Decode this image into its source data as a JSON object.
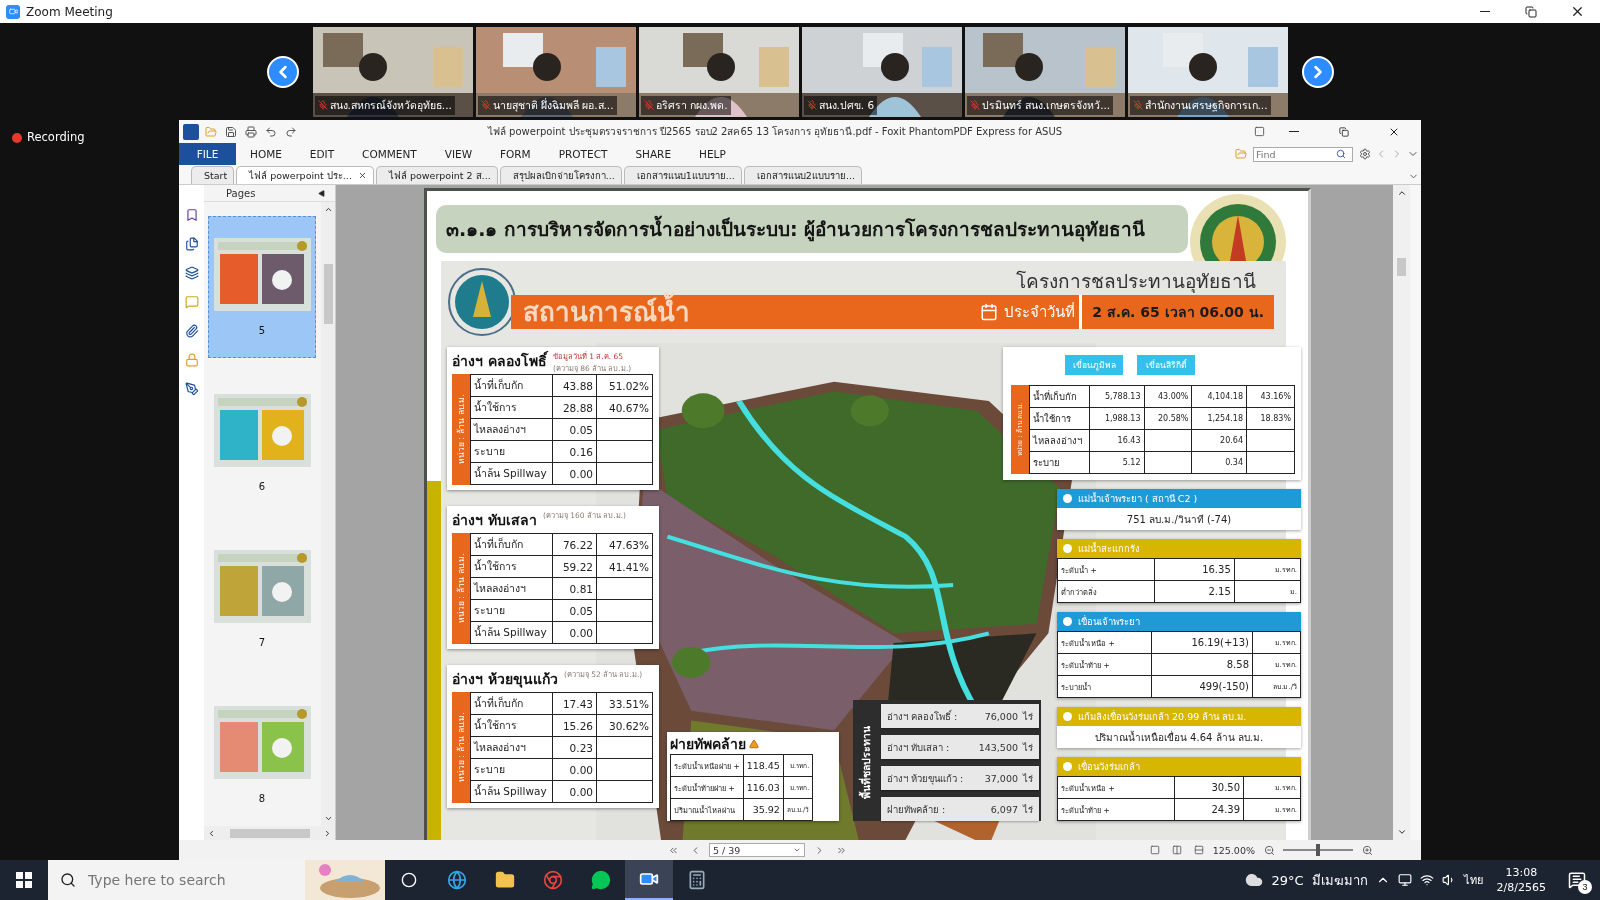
{
  "window": {
    "title": "Zoom Meeting"
  },
  "participants": [
    {
      "name": "สนง.สหกรณ์จังหวัดอุทัยธ..."
    },
    {
      "name": "นายสุชาติ ผึ่งฉิมพลี ผอ.ส..."
    },
    {
      "name": "อริศรา กผง.พด."
    },
    {
      "name": "สนง.ปศข. 6"
    },
    {
      "name": "ปรมินทร์ สนง.เกษตรจังหวั..."
    },
    {
      "name": "สำนักงานเศรษฐกิจการเก..."
    }
  ],
  "recording": "Recording",
  "viewer": {
    "title": "ไฟล์ powerpoint ประชุมตรวจราชการ ปี2565 รอบ2 2สค65 13 โครงการ อุทัยธานี.pdf - Foxit PhantomPDF Express for ASUS",
    "menu": [
      {
        "label": "FILE",
        "selected": true
      },
      {
        "label": "HOME",
        "selected": false
      },
      {
        "label": "EDIT",
        "selected": false
      },
      {
        "label": "COMMENT",
        "selected": false
      },
      {
        "label": "VIEW",
        "selected": false
      },
      {
        "label": "FORM",
        "selected": false
      },
      {
        "label": "PROTECT",
        "selected": false
      },
      {
        "label": "SHARE",
        "selected": false
      },
      {
        "label": "HELP",
        "selected": false
      }
    ],
    "search": {
      "placeholder": "Find"
    },
    "tabs": [
      {
        "label": "Start",
        "selected": false
      },
      {
        "label": "ไฟล์ powerpoint ประ...",
        "selected": true
      },
      {
        "label": "ไฟล์ powerpoint 2 ส...",
        "selected": false
      },
      {
        "label": "สรุปผลเบิกจ่ายโครงกา...",
        "selected": false
      },
      {
        "label": "เอกสารแนบ1แบบราย...",
        "selected": false
      },
      {
        "label": "เอกสารแนบ2แบบราย...",
        "selected": false
      }
    ],
    "pages_panel": {
      "title": "Pages",
      "pages": [
        {
          "number": "5",
          "selected": true
        },
        {
          "number": "6",
          "selected": false
        },
        {
          "number": "7",
          "selected": false
        },
        {
          "number": "8",
          "selected": false
        }
      ]
    },
    "status": {
      "page": "5 / 39",
      "zoom": "125.00%",
      "zoom_slider": {
        "level": 0.5
      }
    }
  },
  "slide": {
    "heading": "๓.๑.๑ การบริหารจัดการน้ำอย่างเป็นระบบ: ผู้อำนวยการโครงการชลประทานอุทัยธานี",
    "banner": "สถานการณ์น้ำ",
    "project": "โครงการชลประทานอุทัยธานี",
    "date_label": "ประจำวันที่",
    "date": "2 ส.ค. 65  เวลา 06.00 น.",
    "reservoirs": [
      {
        "name": "อ่างฯ คลองโพธิ์",
        "note": "ข้อมูลวันที่ 1 ส.ค. 65",
        "capacity": "(ความจุ 86 ล้าน ลบ.ม.)",
        "unit": "หน่วย : ล้าน ลบ.ม.",
        "rows": [
          {
            "label": "น้ำที่เก็บกัก",
            "value": "43.88",
            "percent": "51.02%"
          },
          {
            "label": "น้ำใช้การ",
            "value": "28.88",
            "percent": "40.67%"
          },
          {
            "label": "ไหลลงอ่างฯ",
            "value": "0.05"
          },
          {
            "label": "ระบาย",
            "value": "0.16"
          },
          {
            "label": "น้ำล้น Spillway",
            "value": "0.00"
          }
        ]
      },
      {
        "name": "อ่างฯ ทับเสลา",
        "capacity": "(ความจุ 160 ล้าน ลบ.ม.)",
        "unit": "หน่วย : ล้าน ลบ.ม.",
        "rows": [
          {
            "label": "น้ำที่เก็บกัก",
            "value": "76.22",
            "percent": "47.63%"
          },
          {
            "label": "น้ำใช้การ",
            "value": "59.22",
            "percent": "41.41%"
          },
          {
            "label": "ไหลลงอ่างฯ",
            "value": "0.81"
          },
          {
            "label": "ระบาย",
            "value": "0.05"
          },
          {
            "label": "น้ำล้น Spillway",
            "value": "0.00"
          }
        ]
      },
      {
        "name": "อ่างฯ ห้วยขุนแก้ว",
        "capacity": "(ความจุ 52 ล้าน ลบ.ม.)",
        "unit": "หน่วย : ล้าน ลบ.ม.",
        "rows": [
          {
            "label": "น้ำที่เก็บกัก",
            "value": "17.43",
            "percent": "33.51%"
          },
          {
            "label": "น้ำใช้การ",
            "value": "15.26",
            "percent": "30.62%"
          },
          {
            "label": "ไหลลงอ่างฯ",
            "value": "0.23"
          },
          {
            "label": "ระบาย",
            "value": "0.00"
          },
          {
            "label": "น้ำล้น Spillway",
            "value": "0.00"
          }
        ]
      }
    ],
    "weir": {
      "name": "ฝายทัพคล้าย",
      "rows": [
        {
          "label": "ระดับน้ำเหนือฝาย +",
          "value": "118.45",
          "unit": "ม.รทก."
        },
        {
          "label": "ระดับน้ำท้ายฝาย +",
          "value": "116.03",
          "unit": "ม.รทก."
        },
        {
          "label": "ปริมาณน้ำไหลผ่าน",
          "value": "35.92",
          "unit": "ลบ.ม./วิ"
        }
      ]
    },
    "irrigated": {
      "title": "พื้นที่ชลประทาน",
      "items": [
        {
          "label": "อ่างฯ คลองโพธิ์ :",
          "value": "76,000",
          "unit": "ไร่"
        },
        {
          "label": "อ่างฯ ทับเสลา :",
          "value": "143,500",
          "unit": "ไร่"
        },
        {
          "label": "อ่างฯ ห้วยขุนแก้ว :",
          "value": "37,000",
          "unit": "ไร่"
        },
        {
          "label": "ฝายทัพคล้าย :",
          "value": "6,097",
          "unit": "ไร่"
        }
      ]
    },
    "dams": {
      "columns": [
        "เขื่อนภูมิพล",
        "เขื่อนสิริกิติ์"
      ],
      "unit": "หน่วย : ล้าน ลบ.ม.",
      "rows": [
        {
          "label": "น้ำที่เก็บกัก",
          "values": [
            {
              "amount": "5,788.13",
              "percent": "43.00%"
            },
            {
              "amount": "4,104.18",
              "percent": "43.16%"
            }
          ]
        },
        {
          "label": "น้ำใช้การ",
          "values": [
            {
              "amount": "1,988.13",
              "percent": "20.58%"
            },
            {
              "amount": "1,254.18",
              "percent": "18.83%"
            }
          ]
        },
        {
          "label": "ไหลลงอ่างฯ",
          "values": [
            {
              "amount": "16.43"
            },
            {
              "amount": "20.64"
            }
          ]
        },
        {
          "label": "ระบาย",
          "values": [
            {
              "amount": "5.12"
            },
            {
              "amount": "0.34"
            }
          ]
        }
      ]
    },
    "panels": [
      {
        "kind": "reading",
        "title": "แม่น้ำเจ้าพระยา ( สถานี C2 )",
        "color": "#1e9bd7",
        "text": "751  ลบ.ม./วินาที (-74)"
      },
      {
        "kind": "rows",
        "title": "แม่น้ำสะแกกรัง",
        "color": "#d6b600",
        "rows": [
          {
            "label": "ระดับน้ำ +",
            "value": "16.35",
            "unit": "ม.รทก."
          },
          {
            "label": "ต่ำกว่าตลิ่ง",
            "value": "2.15",
            "unit": "ม."
          }
        ]
      },
      {
        "kind": "rows",
        "title": "เขื่อนเจ้าพระยา",
        "color": "#1e9bd7",
        "rows": [
          {
            "label": "ระดับน้ำเหนือ +",
            "value": "16.19(+13)",
            "unit": "ม.รทก."
          },
          {
            "label": "ระดับน้ำท้าย +",
            "value": "8.58",
            "unit": "ม.รทก."
          },
          {
            "label": "ระบายน้ำ",
            "value": "499(-150)",
            "unit": "ลบ.ม./วิ"
          }
        ]
      },
      {
        "kind": "reading",
        "title": "แก้มลิงเขื่อนวังร่มเกล้า 20.99 ล้าน ลบ.ม.",
        "color": "#d6b600",
        "text": "ปริมาณน้ำเหนือเขื่อน 4.64 ล้าน ลบ.ม."
      },
      {
        "kind": "rows",
        "title": "เขื่อนวังร่มเกล้า",
        "color": "#d6b600",
        "rows": [
          {
            "label": "ระดับน้ำเหนือ +",
            "value": "30.50",
            "unit": "ม.รทก."
          },
          {
            "label": "ระดับน้ำท้าย +",
            "value": "24.39",
            "unit": "ม.รทก."
          }
        ]
      }
    ]
  },
  "taskbar": {
    "search_placeholder": "Type here to search",
    "temperature": "29°C",
    "weather": "มีเมฆมาก",
    "language": "ไทย",
    "time": "13:08",
    "date": "2/8/2565",
    "notifications": "3"
  }
}
